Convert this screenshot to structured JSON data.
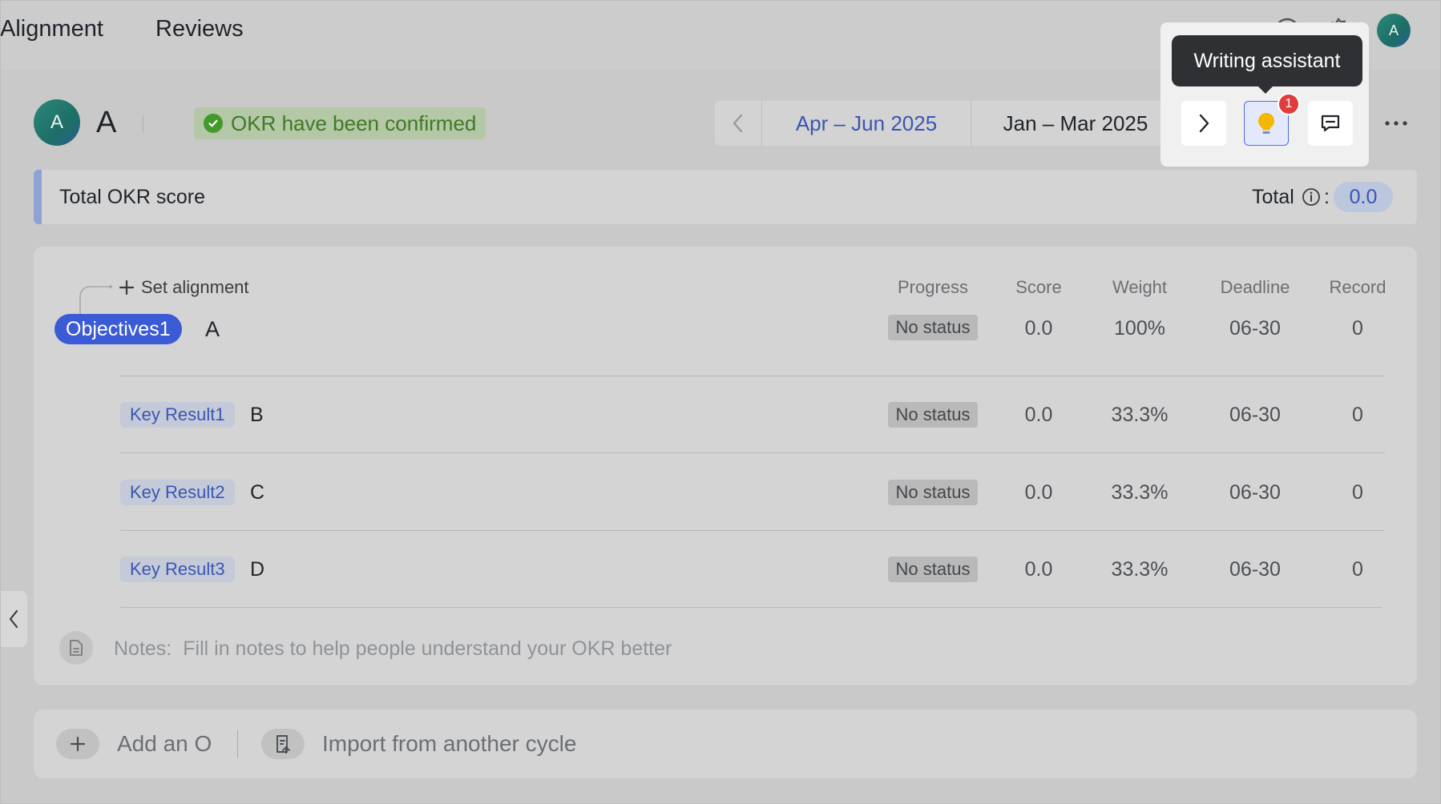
{
  "nav": {
    "tabs": [
      "Alignment",
      "Reviews"
    ]
  },
  "header": {
    "avatar_letter": "A",
    "owner_name": "A",
    "confirmed_badge": "OKR have been confirmed",
    "periods": {
      "current": "Apr – Jun 2025",
      "previous": "Jan – Mar 2025"
    },
    "tooltip": "Writing assistant",
    "notification_count": "1"
  },
  "score": {
    "title": "Total OKR score",
    "total_label": "Total",
    "total_colon": ":",
    "total_value": "0.0"
  },
  "table": {
    "set_alignment": "Set alignment",
    "columns": [
      "Progress",
      "Score",
      "Weight",
      "Deadline",
      "Record"
    ],
    "objective": {
      "tag": "Objectives1",
      "title": "A",
      "progress": "No status",
      "score": "0.0",
      "weight": "100%",
      "deadline": "06-30",
      "record": "0"
    },
    "key_results": [
      {
        "tag": "Key Result1",
        "title": "B",
        "progress": "No status",
        "score": "0.0",
        "weight": "33.3%",
        "deadline": "06-30",
        "record": "0"
      },
      {
        "tag": "Key Result2",
        "title": "C",
        "progress": "No status",
        "score": "0.0",
        "weight": "33.3%",
        "deadline": "06-30",
        "record": "0"
      },
      {
        "tag": "Key Result3",
        "title": "D",
        "progress": "No status",
        "score": "0.0",
        "weight": "33.3%",
        "deadline": "06-30",
        "record": "0"
      }
    ],
    "notes_label": "Notes:",
    "notes_placeholder": "Fill in notes to help people understand your OKR better"
  },
  "actions": {
    "add_objective": "Add an O",
    "import_cycle": "Import from another cycle"
  },
  "colors": {
    "accent_blue": "#3a56b3",
    "confirmed_green": "#43992a",
    "badge_red": "#e03e3e",
    "lightbulb_yellow": "#f5b800"
  }
}
